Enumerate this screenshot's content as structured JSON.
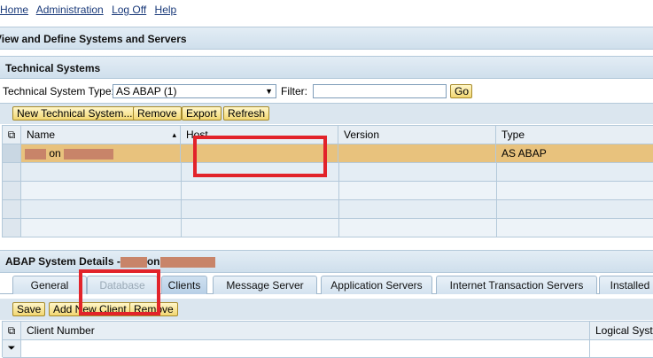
{
  "nav": {
    "home": "Home",
    "administration": "Administration",
    "logoff": "Log Off",
    "help": "Help"
  },
  "page": {
    "title": "View and Define Systems and Servers"
  },
  "tech_systems": {
    "title": "Technical Systems",
    "type_label": "Technical System Type:",
    "type_value": "AS ABAP (1)",
    "filter_label": "Filter:",
    "filter_value": "",
    "go_label": "Go",
    "buttons": {
      "new": "New Technical System...",
      "remove": "Remove",
      "export": "Export",
      "refresh": "Refresh"
    },
    "columns": [
      "Name",
      "Host",
      "Version",
      "Type"
    ],
    "rows": [
      {
        "name_sep": "on",
        "host": "",
        "version": "",
        "type": "AS ABAP"
      }
    ]
  },
  "details": {
    "title_prefix": "ABAP System Details -",
    "title_sep": "on",
    "tabs": [
      "General",
      "Database",
      "Clients",
      "Message Server",
      "Application Servers",
      "Internet Transaction Servers",
      "Installed"
    ],
    "buttons": {
      "save": "Save",
      "add": "Add New Client",
      "remove": "Remove"
    },
    "columns": [
      "Client Number",
      "Logical System"
    ]
  },
  "colors": {
    "accent_bar": "#d5e3ef",
    "selected_row": "#e8c27d",
    "annotation_red": "#e2232a",
    "redaction": "#c88469"
  }
}
